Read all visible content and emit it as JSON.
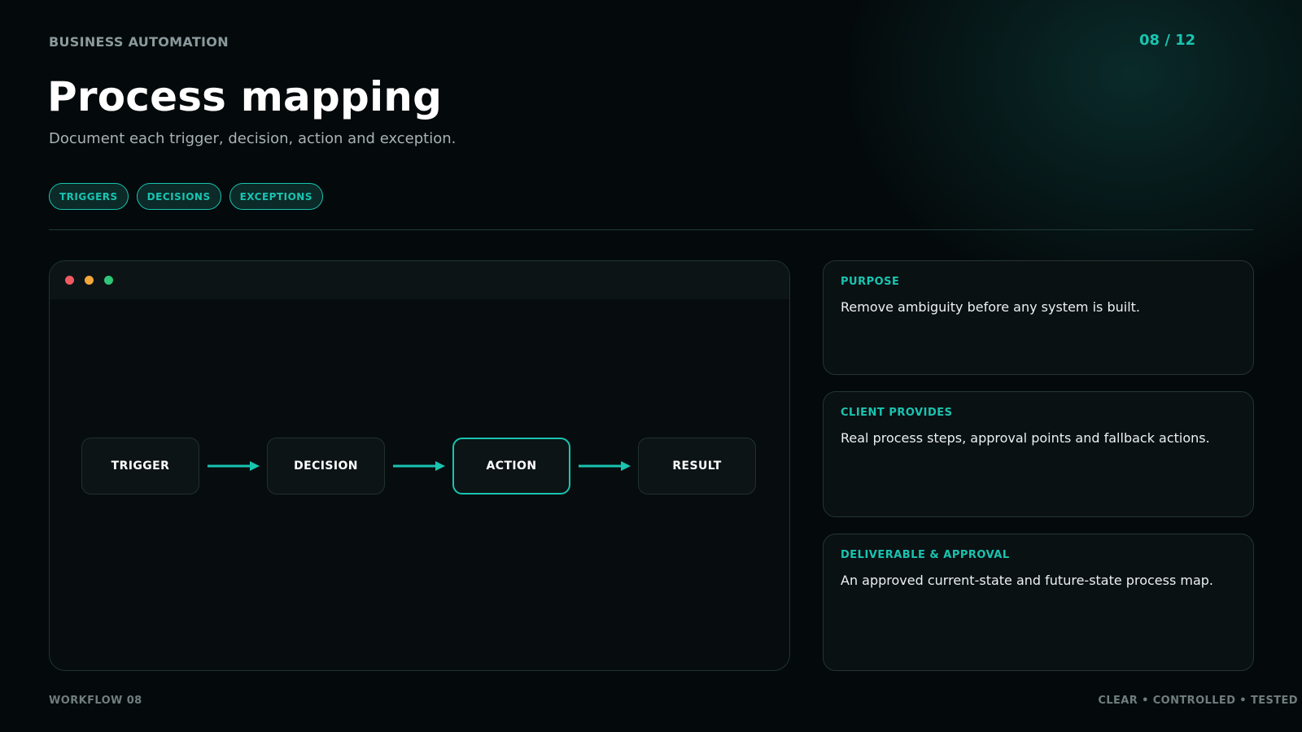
{
  "header": {
    "eyebrow": "BUSINESS AUTOMATION",
    "page_indicator": "08 / 12",
    "title": "Process mapping",
    "subtitle": "Document each trigger, decision, action and exception."
  },
  "tags": [
    "TRIGGERS",
    "DECISIONS",
    "EXCEPTIONS"
  ],
  "window": {
    "controls": [
      "close-dot",
      "minimize-dot",
      "maximize-dot"
    ],
    "flow": [
      {
        "label": "TRIGGER",
        "active": false
      },
      {
        "label": "DECISION",
        "active": false
      },
      {
        "label": "ACTION",
        "active": true
      },
      {
        "label": "RESULT",
        "active": false
      }
    ]
  },
  "cards": [
    {
      "label": "PURPOSE",
      "text": "Remove ambiguity before any system is built."
    },
    {
      "label": "CLIENT PROVIDES",
      "text": "Real process steps, approval points and fallback actions."
    },
    {
      "label": "DELIVERABLE & APPROVAL",
      "text": "An approved current-state and future-state process map."
    }
  ],
  "footer": {
    "left": "WORKFLOW 08",
    "right": "CLEAR • CONTROLLED • TESTED"
  },
  "colors": {
    "accent": "#19c4b0",
    "background": "#04090b",
    "dot_red": "#ef5a62",
    "dot_yellow": "#f2a73a",
    "dot_green": "#2fc678"
  }
}
